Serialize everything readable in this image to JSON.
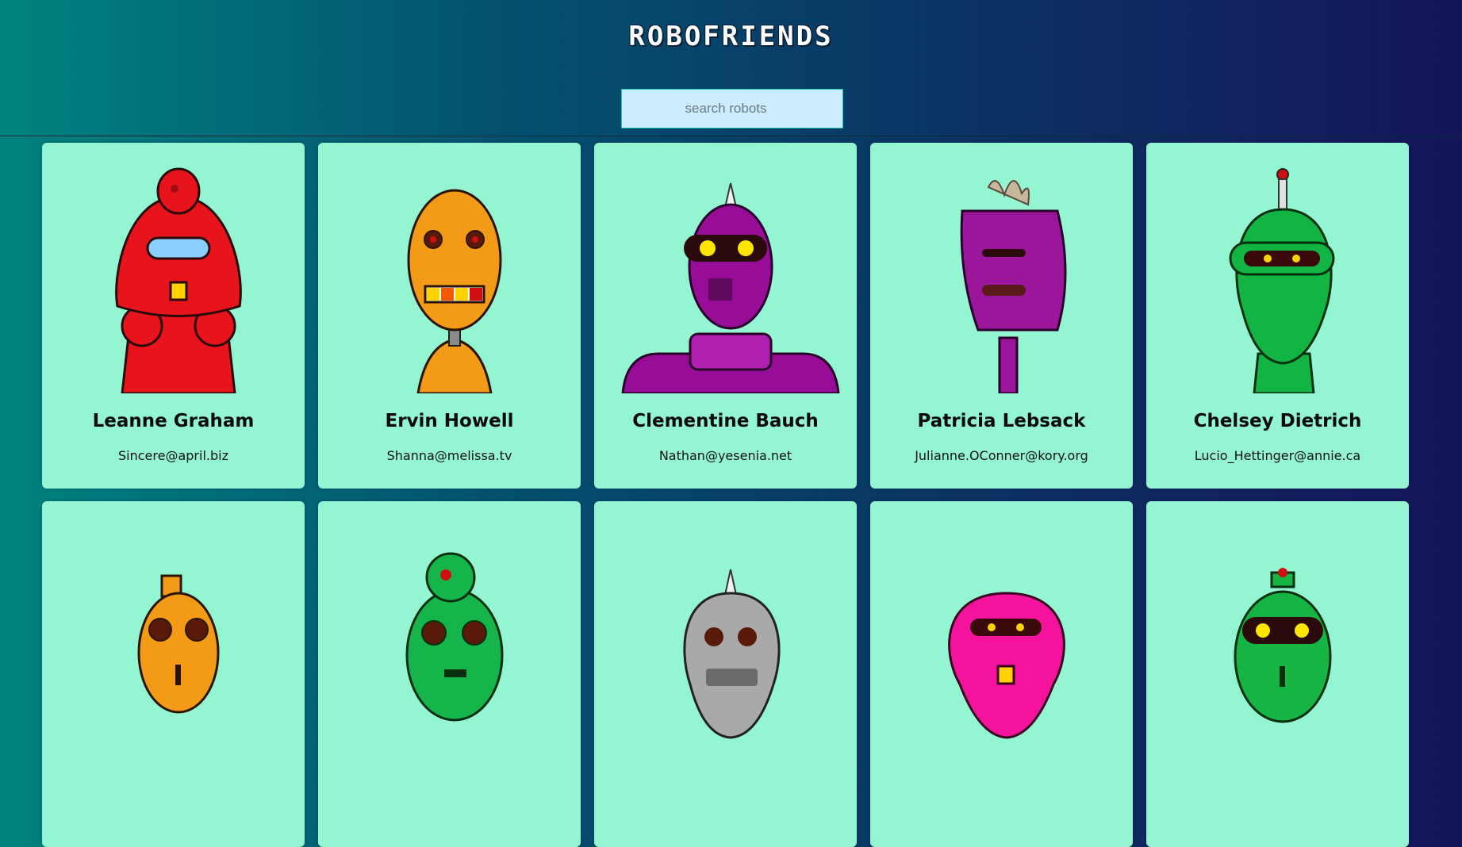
{
  "app": {
    "title": "ROBOFRIENDS"
  },
  "search": {
    "placeholder": "search robots",
    "value": ""
  },
  "robots": [
    {
      "name": "Leanne Graham",
      "email": "Sincere@april.biz",
      "color": "#e8141c",
      "dark": "#9e0d12"
    },
    {
      "name": "Ervin Howell",
      "email": "Shanna@melissa.tv",
      "color": "#f39a16",
      "dark": "#b86b08"
    },
    {
      "name": "Clementine Bauch",
      "email": "Nathan@yesenia.net",
      "color": "#980d98",
      "dark": "#5e0a5e"
    },
    {
      "name": "Patricia Lebsack",
      "email": "Julianne.OConner@kory.org",
      "color": "#9b169b",
      "dark": "#5f0c62"
    },
    {
      "name": "Chelsey Dietrich",
      "email": "Lucio_Hettinger@annie.ca",
      "color": "#12b543",
      "dark": "#0a7029"
    },
    {
      "name": "",
      "email": "",
      "color": "#f39a16",
      "dark": "#b86b08"
    },
    {
      "name": "",
      "email": "",
      "color": "#16b54b",
      "dark": "#0a7029"
    },
    {
      "name": "",
      "email": "",
      "color": "#a9a9aa",
      "dark": "#6b6b6c"
    },
    {
      "name": "",
      "email": "",
      "color": "#f5129c",
      "dark": "#a00c66"
    },
    {
      "name": "",
      "email": "",
      "color": "#16b543",
      "dark": "#0a7029"
    }
  ]
}
